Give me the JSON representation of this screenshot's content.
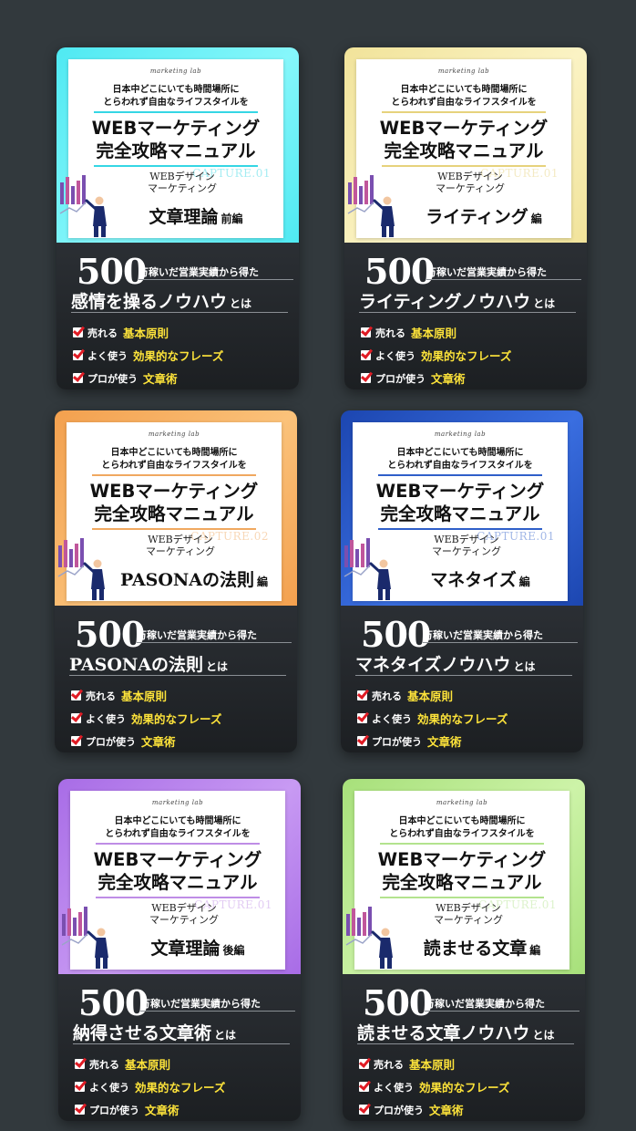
{
  "common": {
    "brand": "marketing lab",
    "tagline_line1": "日本中どこにいても時間場所に",
    "tagline_line2": "とらわれず自由なライフスタイルを",
    "title_line1": "WEBマーケティング",
    "title_line2": "完全攻略マニュアル",
    "sub_line1": "WEBデザイン",
    "sub_line2": "マーケティング",
    "big_number": "500",
    "earn_text": "万稼いだ営業実績から得た",
    "toha": "とは",
    "list": [
      {
        "prefix": "売れる",
        "key": "基本原則"
      },
      {
        "prefix": "よく使う",
        "key": "効果的なフレーズ"
      },
      {
        "prefix": "プロが使う",
        "key": "文章術"
      }
    ]
  },
  "cards": [
    {
      "capture": "CAPTURE.01",
      "volume_main": "文章理論",
      "volume_suffix": "前編",
      "headline": "感情を操るノウハウ",
      "colors": {
        "bg_a": "#4fe9f2",
        "bg_b": "#86f7fb",
        "accent": "#35d6e4"
      }
    },
    {
      "capture": "CAPTURE.01",
      "volume_main": "ライティング",
      "volume_suffix": "編",
      "headline": "ライティングノウハウ",
      "colors": {
        "bg_a": "#f1e39a",
        "bg_b": "#fbf3c4",
        "accent": "#e6d27c"
      }
    },
    {
      "capture": "CAPTURE.02",
      "volume_main": "PASONAの法則",
      "volume_suffix": "編",
      "headline": "PASONAの法則",
      "colors": {
        "bg_a": "#f3a04e",
        "bg_b": "#fbc27a",
        "accent": "#f0a860"
      }
    },
    {
      "capture": "CAPTURE.01",
      "volume_main": "マネタイズ",
      "volume_suffix": "編",
      "headline": "マネタイズノウハウ",
      "colors": {
        "bg_a": "#1c46b0",
        "bg_b": "#3a6ee0",
        "accent": "#2f5fc9"
      }
    },
    {
      "capture": "CAPTURE.01",
      "volume_main": "文章理論",
      "volume_suffix": "後編",
      "headline": "納得させる文章術",
      "colors": {
        "bg_a": "#a86ce6",
        "bg_b": "#c89af3",
        "accent": "#bf8de6"
      }
    },
    {
      "capture": "CAPTURE.01",
      "volume_main": "読ませる文章",
      "volume_suffix": "編",
      "headline": "読ませる文章ノウハウ",
      "colors": {
        "bg_a": "#a7e07a",
        "bg_b": "#cdf3a8",
        "accent": "#b3e38e"
      }
    }
  ]
}
